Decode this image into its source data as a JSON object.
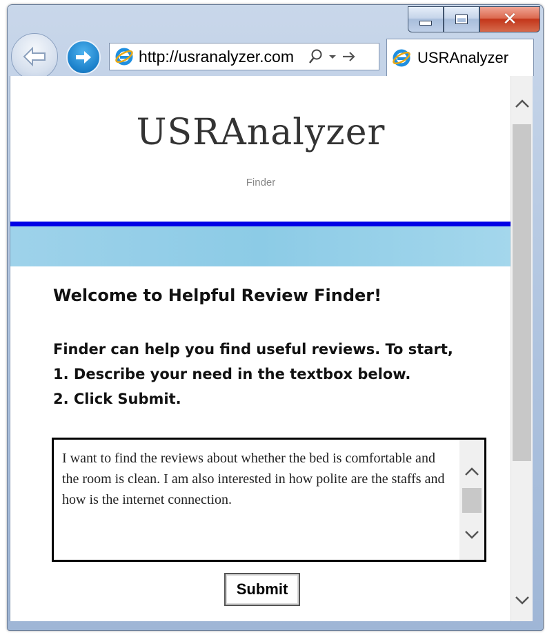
{
  "browser": {
    "address": {
      "url": "http://usranalyzer.com"
    },
    "tab": {
      "title": "USRAnalyzer"
    },
    "icons": [
      "back-arrow-icon",
      "forward-arrow-icon",
      "ie-logo-icon",
      "search-icon",
      "dropdown-icon",
      "go-arrow-icon",
      "minimize-icon",
      "maximize-icon",
      "close-icon"
    ]
  },
  "page": {
    "site_title": "USRAnalyzer",
    "site_subtitle": "Finder",
    "welcome": "Welcome to Helpful Review Finder!",
    "instructions": [
      "Finder can help you find useful reviews. To start,",
      "1. Describe your need in the textbox below.",
      "2. Click Submit."
    ],
    "textbox_value": "I want to find the reviews about whether the bed is comfortable and the room is clean. I am also interested in how polite are the staffs and how is the internet connection.",
    "submit_label": "Submit"
  },
  "colors": {
    "divider": "#0000e6",
    "band": "#8ccbe6",
    "forward_button": "#1a7fc9",
    "close_button": "#c3361a"
  }
}
